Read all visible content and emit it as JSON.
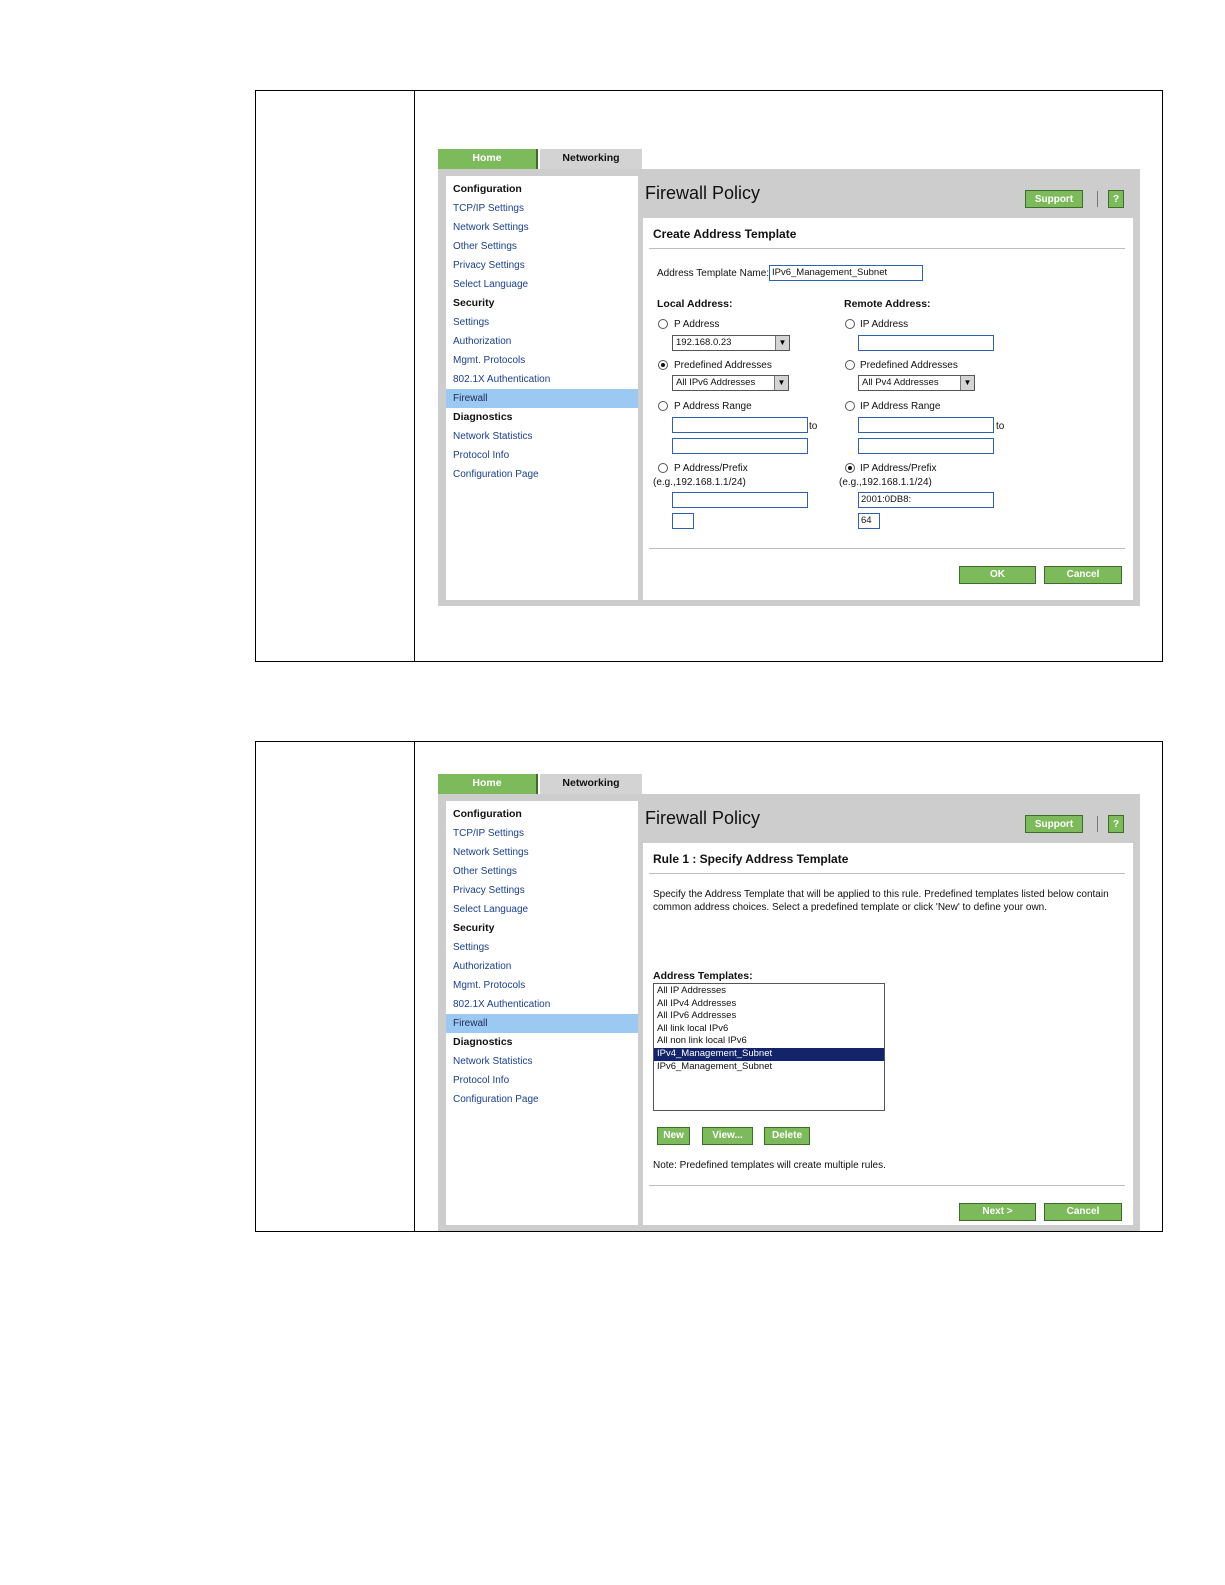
{
  "tabs": {
    "home": "Home",
    "networking": "Networking"
  },
  "nav": {
    "config_header": "Configuration",
    "tcpip": "TCP/IP Settings",
    "network_settings": "Network Settings",
    "other_settings": "Other Settings",
    "privacy_settings": "Privacy Settings",
    "select_language": "Select Language",
    "security_header": "Security",
    "settings": "Settings",
    "authorization": "Authorization",
    "mgmt_protocols": "Mgmt. Protocols",
    "auth_8021x": "802.1X Authentication",
    "firewall": "Firewall",
    "diagnostics_header": "Diagnostics",
    "network_statistics": "Network Statistics",
    "protocol_info": "Protocol Info",
    "config_page": "Configuration Page"
  },
  "page_title": "Firewall Policy",
  "support_label": "Support",
  "help_label": "?",
  "screen1": {
    "section_title": "Create Address Template",
    "template_name_label": "Address Template Name:",
    "template_name_value": "IPv6_Management_Subnet",
    "local_header": "Local Address:",
    "remote_header": "Remote Address:",
    "local": {
      "ip_address_label": "P Address",
      "ip_address_value": "192.168.0.23",
      "predefined_label": "Predefined Addresses",
      "predefined_value": "All IPv6 Addresses",
      "range_label": "P Address Range",
      "to_label": "to",
      "prefix_label": "P Address/Prefix",
      "prefix_hint": "(e.g.,192.168.1.1/24)",
      "prefix_value": "",
      "prefix_len_value": ""
    },
    "remote": {
      "ip_address_label": "IP Address",
      "predefined_label": "Predefined Addresses",
      "predefined_value": "All Pv4 Addresses",
      "range_label": "IP Address Range",
      "to_label": "to",
      "prefix_label": "IP Address/Prefix",
      "prefix_hint": "(e.g.,192.168.1.1/24)",
      "prefix_value": "2001:0DB8:",
      "prefix_len_value": "64"
    },
    "ok_label": "OK",
    "cancel_label": "Cancel"
  },
  "screen2": {
    "section_title": "Rule 1 : Specify Address Template",
    "description_line1": "Specify the Address Template that will be applied to this rule. Predefined templates listed below contain",
    "description_line2": "common address choices. Select a predefined template or click 'New' to define your own.",
    "templates_header": "Address Templates:",
    "templates": [
      "All IP Addresses",
      "All IPv4 Addresses",
      "All IPv6 Addresses",
      "All link local IPv6",
      "All non link local IPv6",
      "IPv4_Management_Subnet",
      "IPv6_Management_Subnet"
    ],
    "selected_template": "IPv4_Management_Subnet",
    "new_label": "New",
    "view_label": "View...",
    "delete_label": "Delete",
    "note": "Note: Predefined templates will create multiple rules.",
    "next_label": "Next >",
    "cancel_label": "Cancel"
  }
}
